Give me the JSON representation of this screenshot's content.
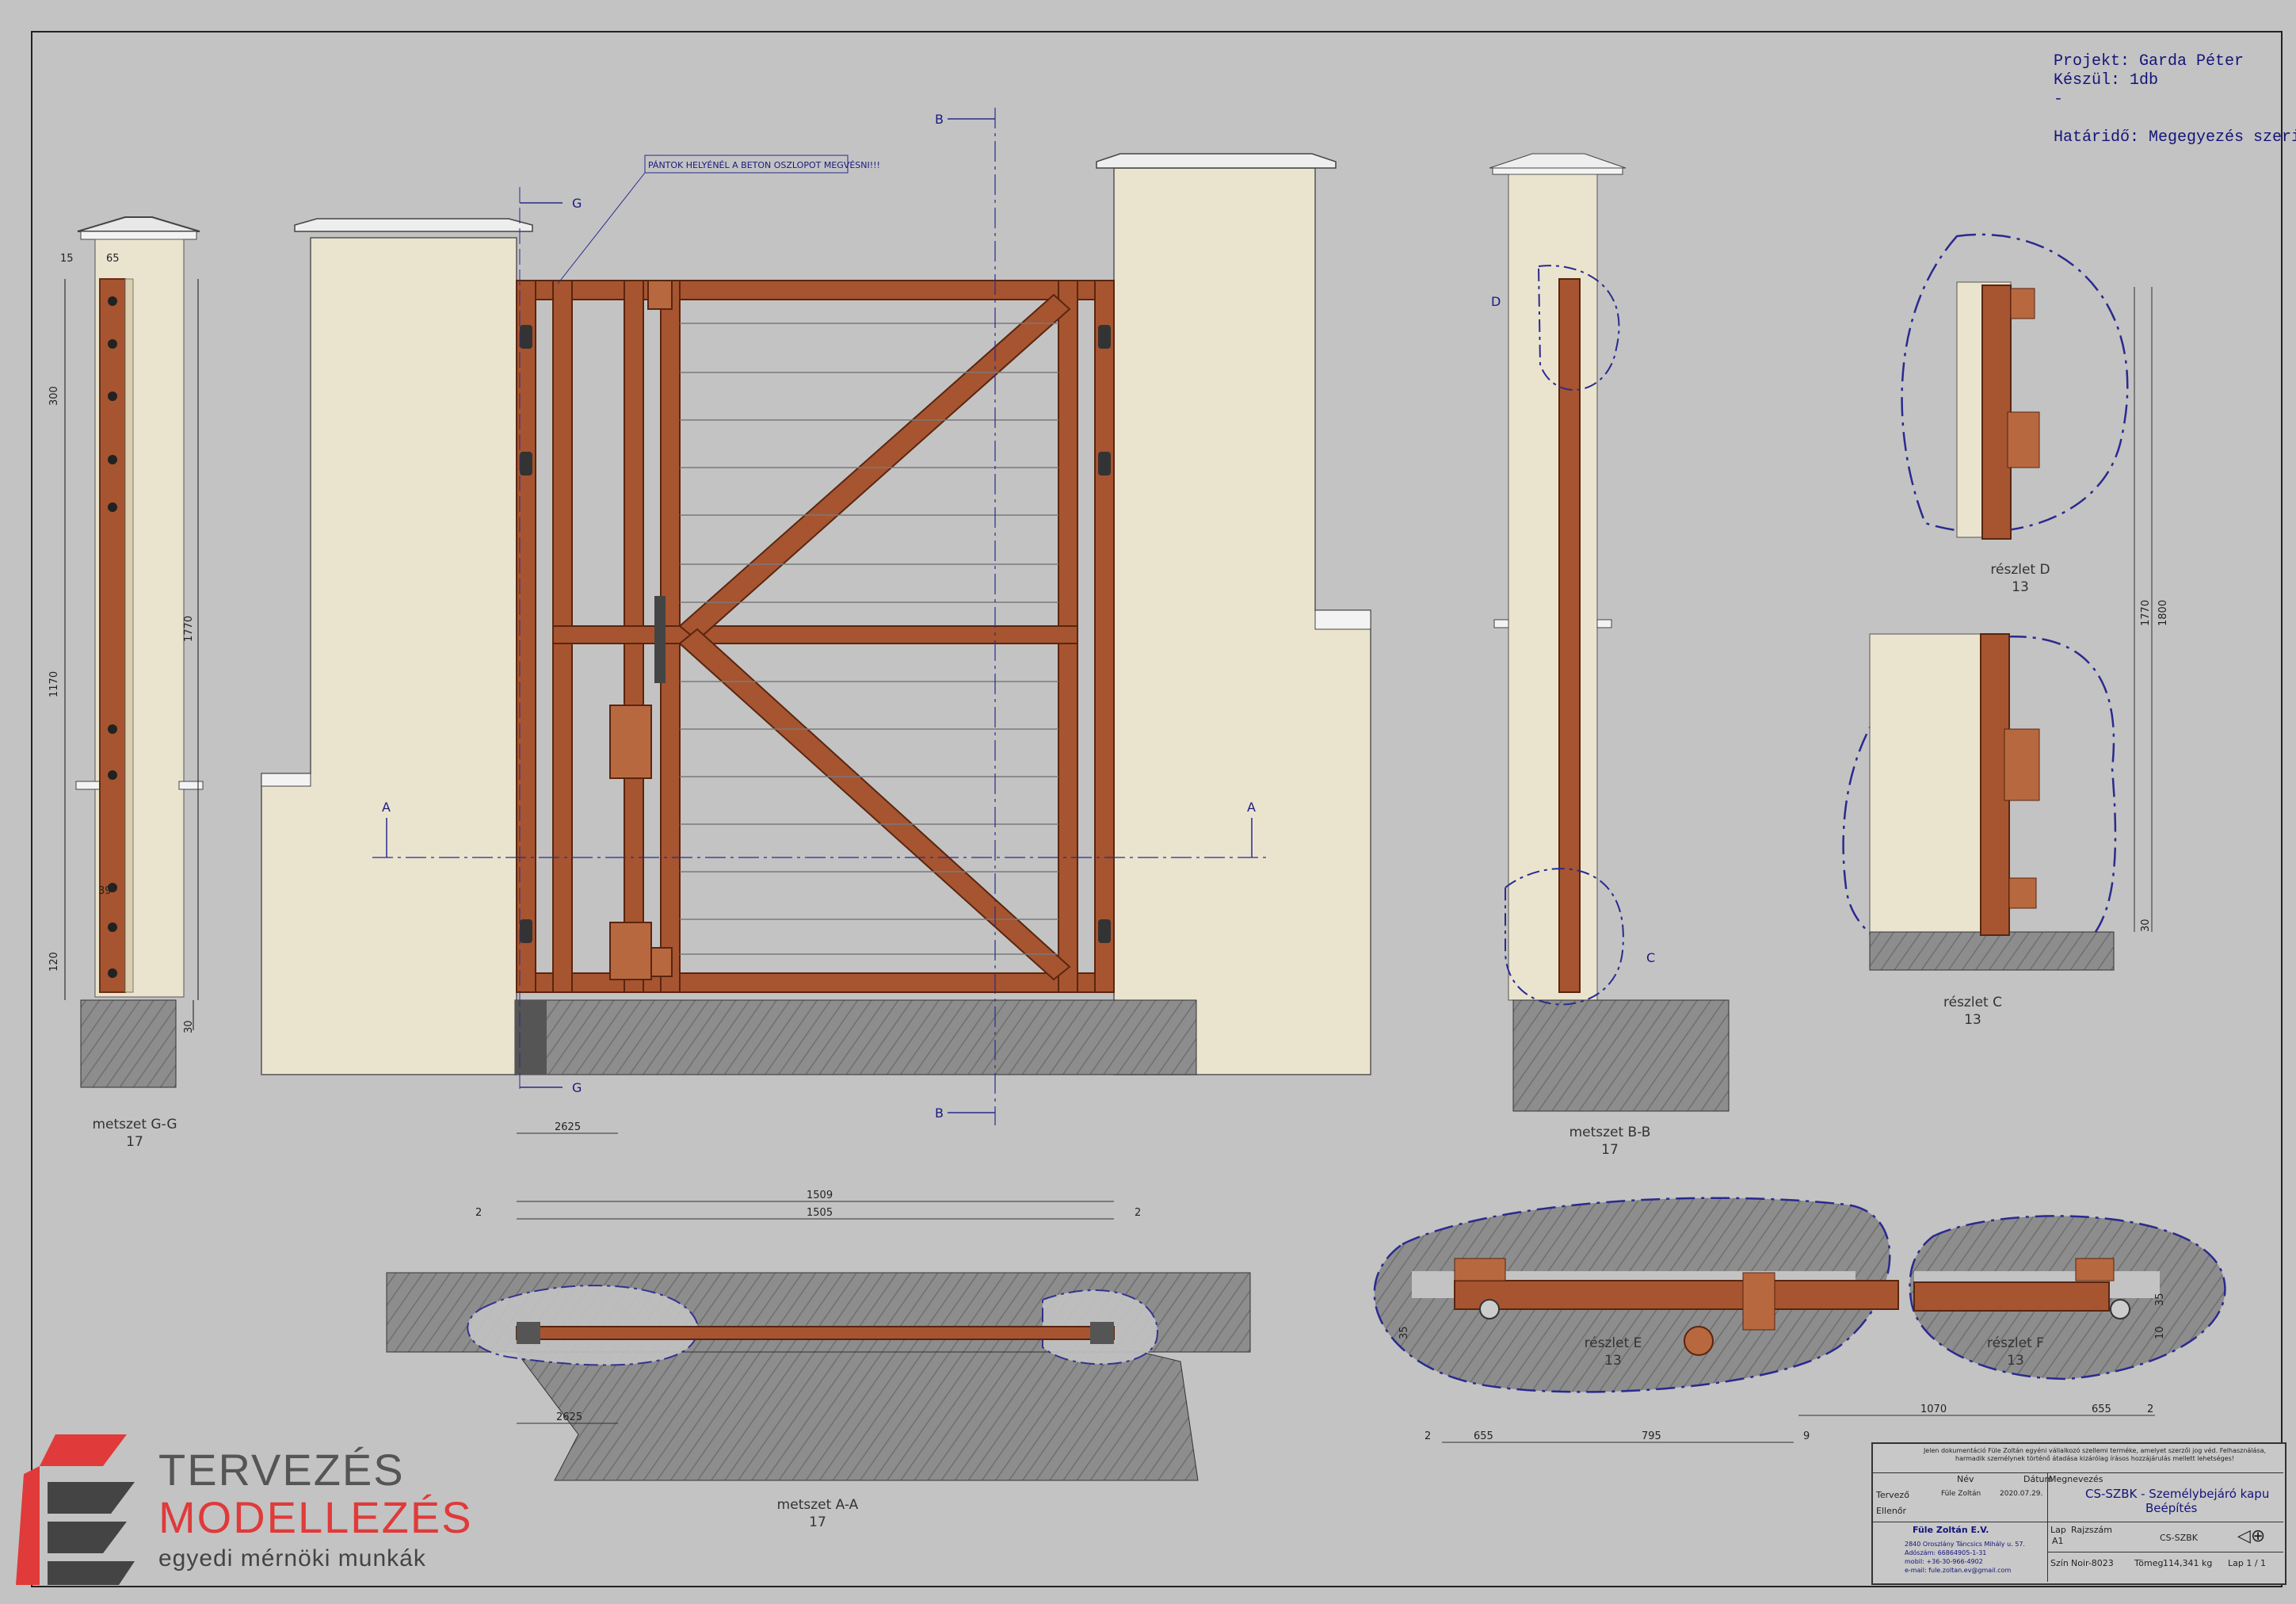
{
  "project": {
    "project_line": "Projekt: Garda Péter",
    "quantity_line": "Készül: 1db",
    "dash_line": "-",
    "deadline_line": "Határidő: Megegyezés szerint"
  },
  "annotations": {
    "note": "PÁNTOK HELYÉNÉL A BETON OSZLOPOT MEGVÉSNI!!!",
    "section_b_top": "B",
    "section_b_bottom": "B",
    "section_g_top": "G",
    "section_g_bottom": "G",
    "section_a_left": "A",
    "section_a_right": "A",
    "detail_d_marker": "D",
    "detail_c_marker": "C"
  },
  "views": {
    "gg": {
      "title": "metszet G-G",
      "scale": "17"
    },
    "bb": {
      "title": "metszet B-B",
      "scale": "17"
    },
    "aa": {
      "title": "metszet A-A",
      "scale": "17"
    },
    "detail_d": {
      "title": "részlet D",
      "scale": "13"
    },
    "detail_c": {
      "title": "részlet C",
      "scale": "13"
    },
    "detail_e": {
      "title": "részlet E",
      "scale": "13"
    },
    "detail_f": {
      "title": "részlet F",
      "scale": "13"
    }
  },
  "dimensions": {
    "gg_top_15": "15",
    "gg_top_65": "65",
    "gg_300": "300",
    "gg_1170": "1170",
    "gg_1770": "1770",
    "gg_39": "39",
    "gg_120": "120",
    "gg_30": "30",
    "front_2625": "2625",
    "aa_1509": "1509",
    "aa_1505": "1505",
    "aa_2_left": "2",
    "aa_2_right": "2",
    "aa_2625": "2625",
    "d_1770": "1770",
    "d_1800": "1800",
    "d_30": "30",
    "e_2": "2",
    "e_655": "655",
    "e_795": "795",
    "e_9": "9",
    "f_1070": "1070",
    "f_655": "655",
    "f_2": "2",
    "e_35": "35",
    "f_35": "35",
    "f_10": "10"
  },
  "title_block": {
    "disclaimer": "Jelen dokumentáció Füle Zoltán egyéni vállalkozó szellemi terméke, amelyet szerzői jog véd. Felhasználása, harmadik személynek történő átadása kizárólag írásos hozzájárulás mellett lehetséges!",
    "col_name": "Név",
    "col_date": "Dátum",
    "row_designer": "Tervező",
    "designer_name": "Füle Zoltán",
    "design_date": "2020.07.29.",
    "row_checker": "Ellenőr",
    "name_label": "Megnevezés",
    "name_value": "CS-SZBK - Személybejáró kapu",
    "name_value2": "Beépítés",
    "company": "Füle Zoltán E.V.",
    "address1": "2840 Oroszlány Táncsics Mihály u. 57.",
    "address2": "Adószám: 66864905-1-31",
    "phone": "mobil: +36-30-966-4902",
    "email": "e-mail: fule.zoltan.ev@gmail.com",
    "size_label": "Lap",
    "size_value": "A1",
    "drawing_no_label": "Rajzszám",
    "drawing_no": "CS-SZBK",
    "material_label": "Szín",
    "material_value": "Noir-8023",
    "weight_label": "Tömeg",
    "weight_value": "114,341 kg",
    "sheet": "Lap 1 / 1"
  },
  "logo": {
    "line1": "TERVEZÉS",
    "line2": "MODELLEZÉS",
    "line3": "egyedi mérnöki munkák"
  },
  "colors": {
    "steel": "#a65530",
    "steel_dark": "#6b2e15",
    "pillar": "#eae4cf",
    "concrete": "#8f8f8f",
    "background": "#c3c3c3",
    "ink": "#1a1a80"
  }
}
